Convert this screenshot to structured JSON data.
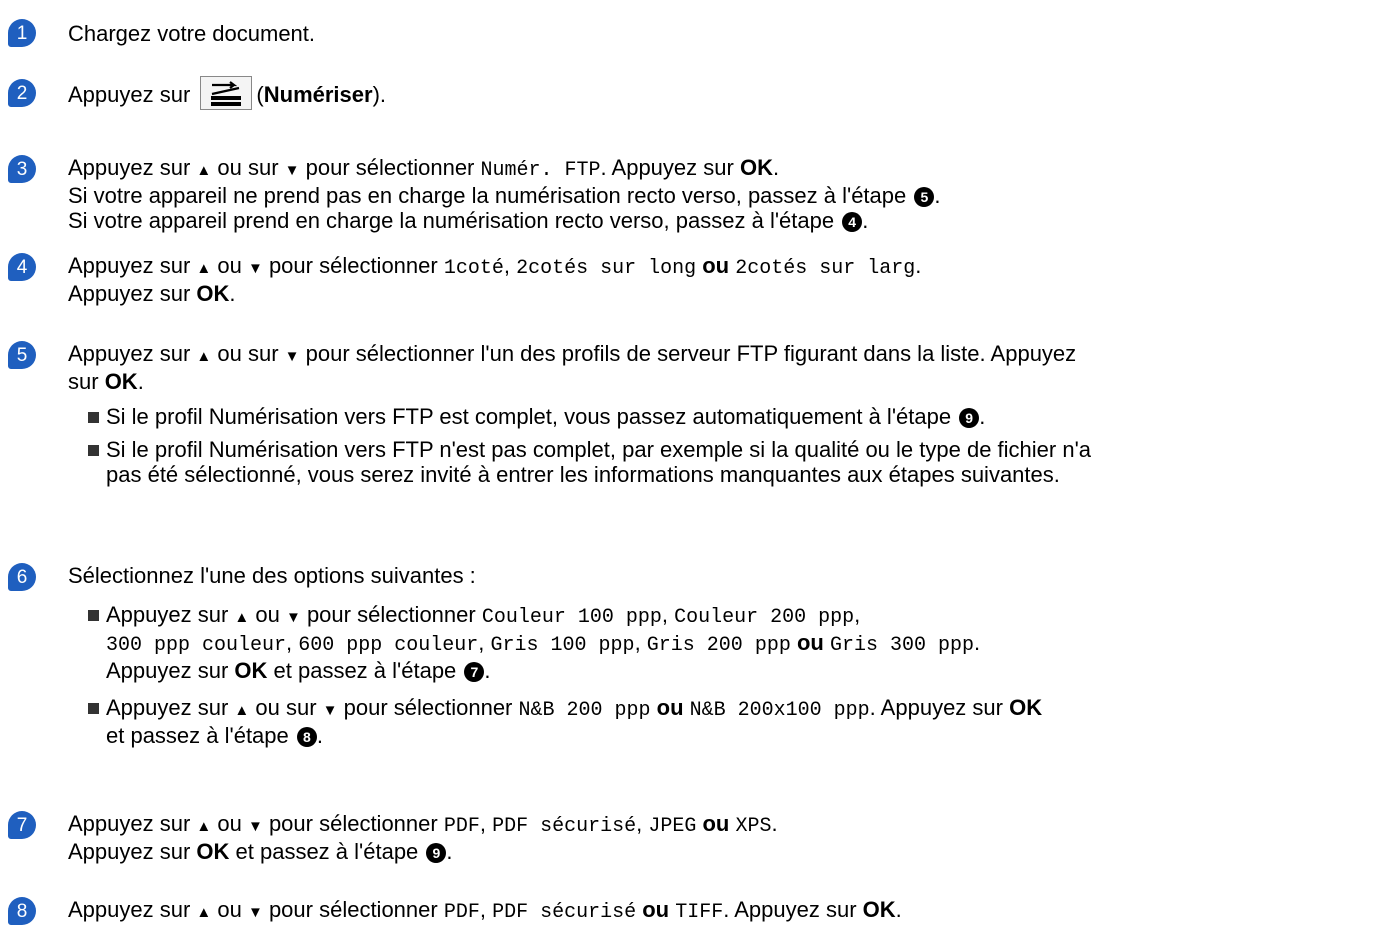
{
  "steps": [
    {
      "n": "1",
      "lines": [
        [
          "Chargez votre document."
        ]
      ]
    },
    {
      "n": "2",
      "prefix": "Appuyez sur",
      "label": "Numériser",
      "suffix": ")."
    },
    {
      "n": "3",
      "a": "Appuyez sur ",
      "b": " ou sur ",
      "c": " pour sélectionner ",
      "mono1": "Numér. FTP",
      "d": ". Appuyez sur ",
      "ok": "OK",
      "e": ".",
      "l2": "Si votre appareil ne prend pas en charge la numérisation recto verso, passez à l'étape ",
      "l2n": "5",
      "l2e": ".",
      "l3": "Si votre appareil prend en charge la numérisation recto verso, passez à l'étape ",
      "l3n": "4",
      "l3e": "."
    },
    {
      "n": "4",
      "a": "Appuyez sur ",
      "b": " ou ",
      "c": " pour sélectionner ",
      "m1": "1coté",
      "sep1": ", ",
      "m2": "2cotés sur long",
      "ou": " ou ",
      "m3": "2cotés sur larg",
      "e": ".",
      "l2": "Appuyez sur ",
      "ok": "OK",
      "l2e": "."
    },
    {
      "n": "5",
      "a": "Appuyez sur ",
      "b": " ou sur ",
      "c": " pour sélectionner l'un des profils de serveur FTP figurant dans la liste. Appuyez",
      "l2": "sur ",
      "ok": "OK",
      "l2e": ".",
      "bul1": "Si le profil Numérisation vers FTP est complet, vous passez automatiquement à l'étape ",
      "bul1n": "9",
      "bul1e": ".",
      "bul2a": "Si le profil Numérisation vers FTP n'est pas complet, par exemple si la qualité ou le type de fichier n'a",
      "bul2b": "pas été sélectionné, vous serez invité à entrer les informations manquantes aux étapes suivantes."
    },
    {
      "n": "6",
      "title": "Sélectionnez l'une des options suivantes :",
      "b1a": "Appuyez sur ",
      "b1b": " ou ",
      "b1c": " pour sélectionner ",
      "m1": "Couleur 100 ppp",
      "m2": "Couleur 200 ppp",
      "m3": "300 ppp couleur",
      "m4": "600 ppp couleur",
      "m5": "Gris 100 ppp",
      "m6": "Gris 200 ppp",
      "ou": " ou ",
      "m7": "Gris 300 ppp",
      "b1l3": "Appuyez sur ",
      "ok": "OK",
      "b1l3b": " et passez à l'étape ",
      "b1n": "7",
      "b1e": ".",
      "b2a": "Appuyez sur ",
      "b2b": " ou sur ",
      "b2c": " pour sélectionner ",
      "b2m1": "N&B 200 ppp",
      "b2m2": "N&B 200x100 ppp",
      "b2d": ". Appuyez sur ",
      "b2l2": "et passez à l'étape ",
      "b2n": "8",
      "b2e": "."
    },
    {
      "n": "7",
      "a": "Appuyez sur ",
      "b": " ou ",
      "c": " pour sélectionner ",
      "m1": "PDF",
      "m2": "PDF sécurisé",
      "m3": "JPEG",
      "ou": " ou ",
      "m4": "XPS",
      "e": ".",
      "l2": "Appuyez sur ",
      "ok": "OK",
      "l2b": " et passez à l'étape ",
      "l2n": "9",
      "l2e": "."
    },
    {
      "n": "8",
      "a": "Appuyez sur ",
      "b": " ou ",
      "c": " pour sélectionner ",
      "m1": "PDF",
      "m2": "PDF sécurisé",
      "ou": " ou ",
      "m3": "TIFF",
      "d": ". Appuyez sur ",
      "ok": "OK",
      "e": "."
    }
  ],
  "symbols": {
    "up": "▲",
    "down": "▼",
    "comma": ", "
  },
  "icons": {
    "scan": "scan-icon",
    "bullet": "square-bullet-icon",
    "step": "step-number-badge"
  },
  "colors": {
    "badge": "#1f5fbf",
    "text": "#000000"
  }
}
